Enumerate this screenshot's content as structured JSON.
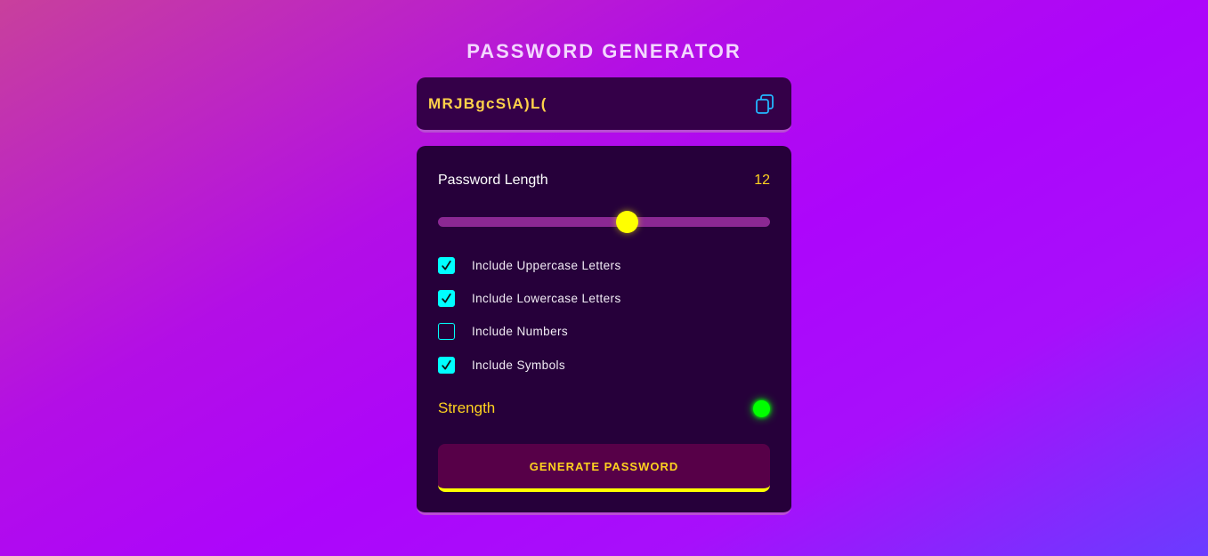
{
  "title": "PASSWORD GENERATOR",
  "display": {
    "password": "MRJBgcS\\A)L(",
    "copy_icon": "copy-icon"
  },
  "length": {
    "label": "Password Length",
    "value": "12",
    "slider_fraction": 0.57
  },
  "options": [
    {
      "label": "Include Uppercase Letters",
      "checked": true
    },
    {
      "label": "Include Lowercase Letters",
      "checked": true
    },
    {
      "label": "Include Numbers",
      "checked": false
    },
    {
      "label": "Include Symbols",
      "checked": true
    }
  ],
  "strength": {
    "label": "Strength",
    "color": "#00ff00"
  },
  "generate_button": "GENERATE PASSWORD",
  "colors": {
    "accent_yellow": "#ffd21f",
    "checkbox_cyan": "#00ffff",
    "card_bg": "#26003a"
  }
}
